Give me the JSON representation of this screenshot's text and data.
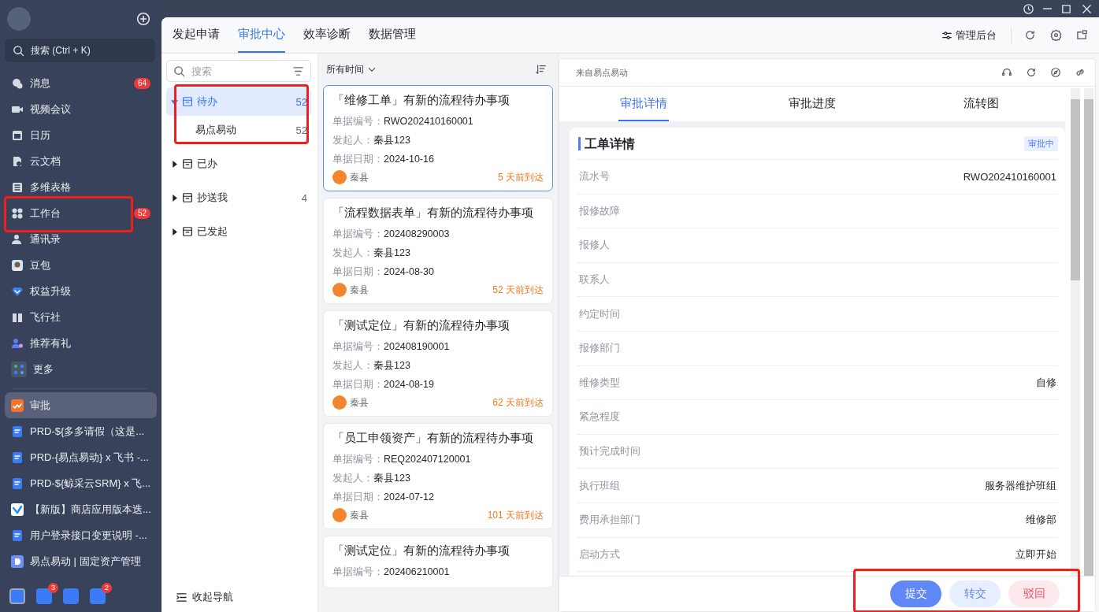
{
  "sidebar": {
    "search": {
      "placeholder": "搜索 (Ctrl + K)"
    },
    "nav": [
      {
        "label": "消息",
        "badge": "64",
        "selected": false
      },
      {
        "label": "视频会议",
        "selected": false
      },
      {
        "label": "日历",
        "selected": false
      },
      {
        "label": "云文档",
        "selected": false
      },
      {
        "label": "多维表格",
        "selected": false
      },
      {
        "label": "工作台",
        "badge": "52",
        "selected": false
      },
      {
        "label": "通讯录",
        "selected": false
      },
      {
        "label": "豆包",
        "selected": false
      },
      {
        "label": "权益升级",
        "selected": false
      },
      {
        "label": "飞行社",
        "selected": false
      },
      {
        "label": "推荐有礼",
        "selected": false
      },
      {
        "label": "更多",
        "selected": false
      }
    ],
    "recent": [
      {
        "label": "审批",
        "selected": true
      },
      {
        "label": "PRD-${多多请假（这是...",
        "selected": false
      },
      {
        "label": "PRD-{易点易动} x 飞书 -...",
        "selected": false
      },
      {
        "label": "PRD-${鲸采云SRM} x 飞...",
        "selected": false
      },
      {
        "label": "【新版】商店应用版本迭...",
        "selected": false
      },
      {
        "label": "用户登录接口变更说明 -...",
        "selected": false
      },
      {
        "label": "易点易动 | 固定资产管理",
        "selected": false
      }
    ],
    "workspaces": [
      {
        "selected": true
      },
      {
        "selected": false,
        "badge": "3"
      },
      {
        "selected": false
      },
      {
        "selected": false,
        "badge": "2"
      }
    ]
  },
  "tabs": [
    {
      "label": "发起申请",
      "selected": false
    },
    {
      "label": "审批中心",
      "selected": true
    },
    {
      "label": "效率诊断",
      "selected": false
    },
    {
      "label": "数据管理",
      "selected": false
    }
  ],
  "admin_button": "管理后台",
  "tree": {
    "search": {
      "placeholder": "搜索"
    },
    "items": [
      {
        "label": "待办",
        "count": "52",
        "expanded": true,
        "selected": true,
        "children": [
          {
            "label": "易点易动",
            "count": "52",
            "selected": false
          }
        ]
      },
      {
        "label": "已办",
        "expanded": false,
        "selected": false
      },
      {
        "label": "抄送我",
        "count": "4",
        "expanded": false,
        "selected": false
      },
      {
        "label": "已发起",
        "expanded": false,
        "selected": false
      }
    ],
    "collapse_button": "收起导航"
  },
  "list": {
    "filter": "所有时间",
    "cards": [
      {
        "title": "「维修工单」有新的流程待办事项",
        "selected": true,
        "fields": [
          {
            "label": "单据编号：",
            "value": "RWO202410160001"
          },
          {
            "label": "发起人：",
            "value": "秦县123"
          },
          {
            "label": "单据日期：",
            "value": "2024-10-16"
          }
        ],
        "assignee": "秦县",
        "arrival": "5 天前到达"
      },
      {
        "title": "「流程数据表单」有新的流程待办事项",
        "selected": false,
        "fields": [
          {
            "label": "单据编号：",
            "value": "202408290003"
          },
          {
            "label": "发起人：",
            "value": "秦县123"
          },
          {
            "label": "单据日期：",
            "value": "2024-08-30"
          }
        ],
        "assignee": "秦县",
        "arrival": "52 天前到达"
      },
      {
        "title": "「测试定位」有新的流程待办事项",
        "selected": false,
        "fields": [
          {
            "label": "单据编号：",
            "value": "202408190001"
          },
          {
            "label": "发起人：",
            "value": "秦县123"
          },
          {
            "label": "单据日期：",
            "value": "2024-08-19"
          }
        ],
        "assignee": "秦县",
        "arrival": "62 天前到达"
      },
      {
        "title": "「员工申领资产」有新的流程待办事项",
        "selected": false,
        "fields": [
          {
            "label": "单据编号：",
            "value": "REQ202407120001"
          },
          {
            "label": "发起人：",
            "value": "秦县123"
          },
          {
            "label": "单据日期：",
            "value": "2024-07-12"
          }
        ],
        "assignee": "秦县",
        "arrival": "101 天前到达"
      },
      {
        "title": "「测试定位」有新的流程待办事项",
        "selected": false,
        "fields": [
          {
            "label": "单据编号：",
            "value": "202406210001"
          }
        ]
      }
    ]
  },
  "detail": {
    "source": "来自易点易动",
    "tabs": [
      {
        "label": "审批详情",
        "selected": true
      },
      {
        "label": "审批进度",
        "selected": false
      },
      {
        "label": "流转图",
        "selected": false
      }
    ],
    "section": {
      "title": "工单详情",
      "status": "审批中",
      "rows": [
        {
          "label": "流水号",
          "value": "RWO202410160001"
        },
        {
          "label": "报修故障"
        },
        {
          "label": "报修人"
        },
        {
          "label": "联系人"
        },
        {
          "label": "约定时间"
        },
        {
          "label": "报修部门"
        },
        {
          "label": "维修类型",
          "value": "自修"
        },
        {
          "label": "紧急程度"
        },
        {
          "label": "预计完成时间"
        },
        {
          "label": "执行班组",
          "value": "服务器维护班组"
        },
        {
          "label": "费用承担部门",
          "value": "维修部"
        },
        {
          "label": "启动方式",
          "value": "立即开始"
        }
      ]
    },
    "actions": [
      {
        "label": "提交",
        "kind": "primary"
      },
      {
        "label": "转交",
        "kind": "secondary"
      },
      {
        "label": "驳回",
        "kind": "danger"
      }
    ]
  }
}
